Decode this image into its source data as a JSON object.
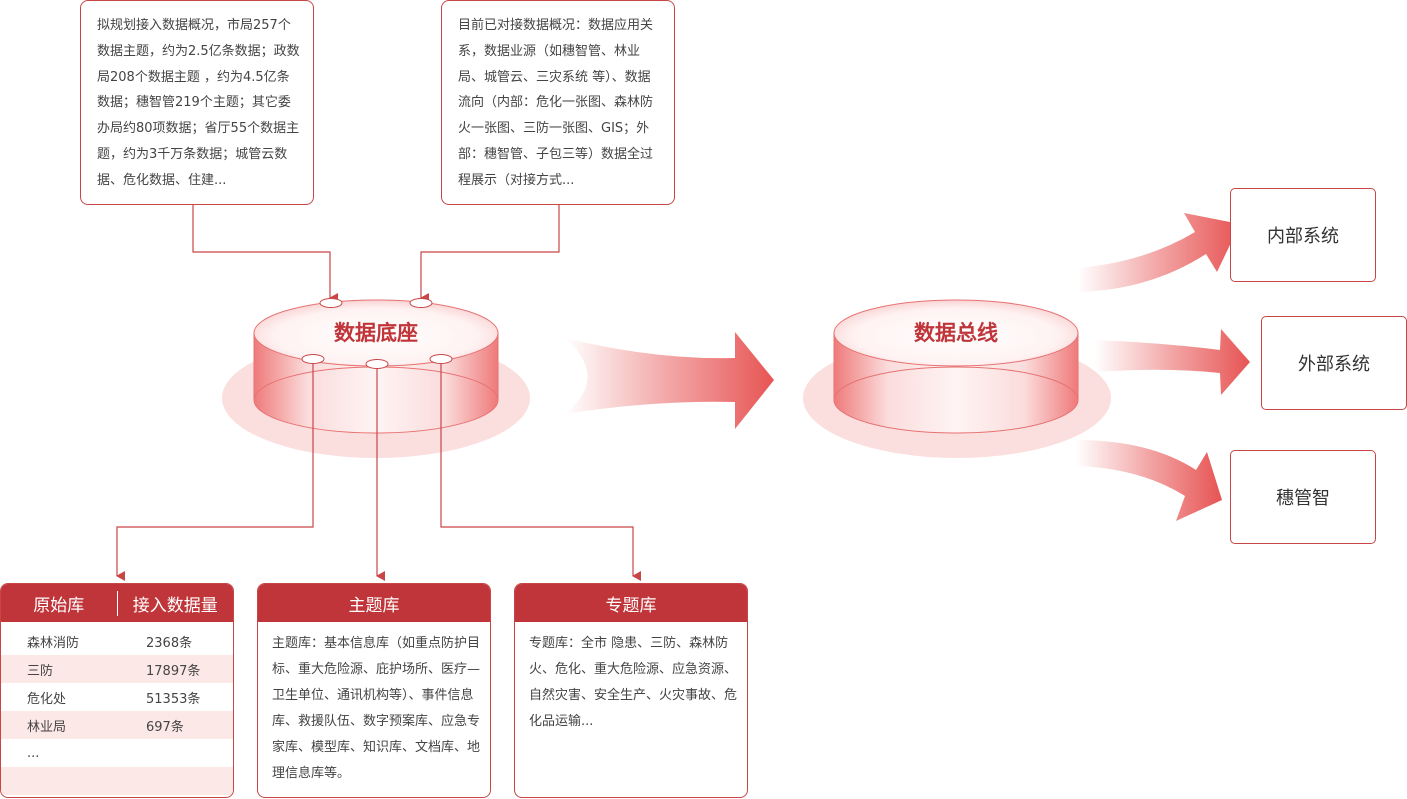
{
  "notes": {
    "planned": "拟规划接入数据概况，市局257个数据主题，约为2.5亿条数据；政数局208个数据主题 ，约为4.5亿条数据；穗智管219个主题；其它委办局约80项数据；省厅55个数据主题，约为3千万条数据；城管云数据、危化数据、住建...",
    "connected": "目前已对接数据概况：数据应用关系，数据业源（如穗智管、林业局、城管云、三灾系统 等）、数据流向（内部：危化一张图、森林防火一张图、三防一张图、GIS；外部：穗智管、子包三等）数据全过程展示（对接方式..."
  },
  "cylinders": {
    "base": "数据底座",
    "bus": "数据总线"
  },
  "targets": {
    "internal": "内部系统",
    "external": "外部系统",
    "suiguanzhi": "穗管智"
  },
  "raw_db": {
    "col1": "原始库",
    "col2": "接入数据量",
    "rows": [
      {
        "name": "森林消防",
        "count": "2368条"
      },
      {
        "name": "三防",
        "count": "17897条"
      },
      {
        "name": "危化处",
        "count": "51353条"
      },
      {
        "name": "林业局",
        "count": "697条"
      },
      {
        "name": "...",
        "count": ""
      },
      {
        "name": "",
        "count": ""
      }
    ]
  },
  "topic_db": {
    "title": "主题库",
    "body": "主题库：基本信息库（如重点防护目标、重大危险源、庇护场所、医疗—卫生单位、通讯机构等）、事件信息库、救援队伍、数字预案库、应急专家库、模型库、知识库、文档库、地理信息库等。"
  },
  "special_db": {
    "title": "专题库",
    "body": "专题库：全市 隐患、三防、森林防火、危化、重大危险源、应急资源、自然灾害、安全生产、火灾事故、危化品运输..."
  },
  "colors": {
    "accent": "#c0353a",
    "border": "#c94646",
    "light": "#fde8e8"
  }
}
